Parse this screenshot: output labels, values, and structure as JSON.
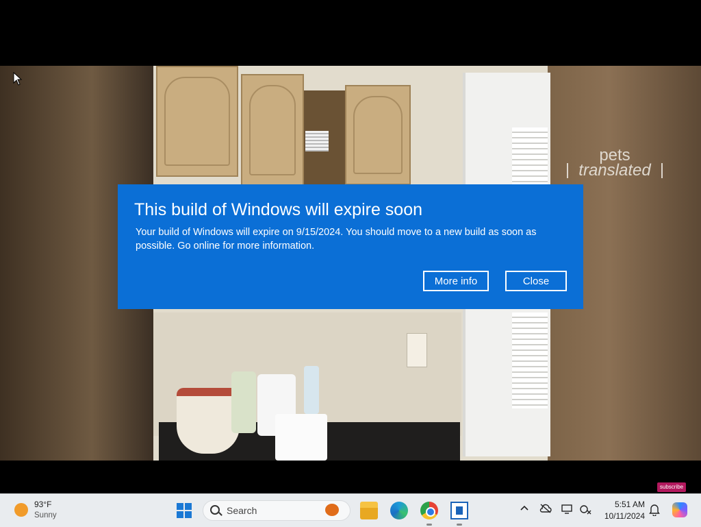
{
  "video": {
    "watermark_line1": "pets",
    "watermark_line2": "translated",
    "subscribe_label": "subscribe"
  },
  "dialog": {
    "title": "This build of Windows will expire soon",
    "message": "Your build of Windows will expire on 9/15/2024. You should move to a new build as soon as possible. Go online for more information.",
    "more_info_label": "More info",
    "close_label": "Close",
    "background_color": "#0b6fd6"
  },
  "taskbar": {
    "weather": {
      "temp": "93°F",
      "condition": "Sunny",
      "icon": "sun-icon"
    },
    "search_placeholder": "Search",
    "pinned_apps": [
      "start-icon",
      "file-explorer-icon",
      "edge-icon",
      "chrome-icon",
      "app-window-icon"
    ],
    "clock": {
      "time": "5:51 AM",
      "date": "10/11/2024"
    },
    "tray_icons": [
      "chevron-up-icon",
      "cloud-off-icon",
      "display-icon",
      "wifi-off-icon",
      "bell-icon",
      "copilot-icon"
    ]
  }
}
